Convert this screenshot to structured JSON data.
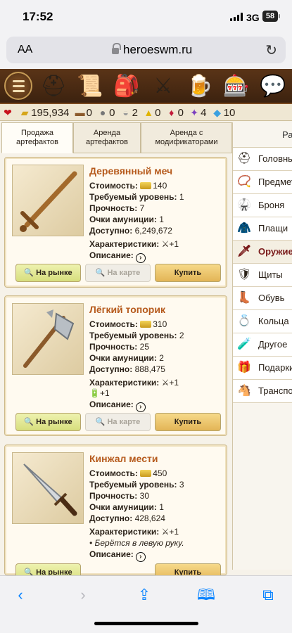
{
  "status_bar": {
    "time": "17:52",
    "network": "3G",
    "battery": "58"
  },
  "browser": {
    "text_size_label": "AA",
    "url": "heroeswm.ru"
  },
  "game_nav": {
    "icons": [
      "menu-icon",
      "helmet-icon",
      "map-scroll-icon",
      "inventory-bag-icon",
      "crossed-swords-icon",
      "tavern-mug-icon",
      "roulette-icon",
      "chat-icon"
    ]
  },
  "resources": [
    {
      "icon": "health-icon",
      "value": ""
    },
    {
      "icon": "gold-icon",
      "value": "195,934"
    },
    {
      "icon": "wood-icon",
      "value": "0"
    },
    {
      "icon": "ore-icon",
      "value": "0"
    },
    {
      "icon": "mercury-icon",
      "value": "2"
    },
    {
      "icon": "sulfur-icon",
      "value": "0"
    },
    {
      "icon": "crystal-icon",
      "value": "0"
    },
    {
      "icon": "gems-icon",
      "value": "4"
    },
    {
      "icon": "diamond-icon",
      "value": "10"
    }
  ],
  "tabs": [
    {
      "label": "Продажа артефактов"
    },
    {
      "label": "Аренда артефактов"
    },
    {
      "label": "Аренда с модификаторами"
    }
  ],
  "sidebar": {
    "header": "Ра",
    "items": [
      {
        "label": "Головные",
        "icon": "helmet-icon"
      },
      {
        "label": "Предметы",
        "icon": "necklace-icon"
      },
      {
        "label": "Броня",
        "icon": "armor-icon"
      },
      {
        "label": "Плащи",
        "icon": "cloak-icon"
      },
      {
        "label": "Оружие",
        "icon": "sword-icon"
      },
      {
        "label": "Щиты",
        "icon": "shield-icon"
      },
      {
        "label": "Обувь",
        "icon": "boots-icon"
      },
      {
        "label": "Кольца",
        "icon": "ring-icon"
      },
      {
        "label": "Другое",
        "icon": "misc-icon"
      },
      {
        "label": "Подарки",
        "icon": "gift-icon"
      },
      {
        "label": "Транспорт",
        "icon": "horse-icon"
      }
    ]
  },
  "labels": {
    "cost": "Стоимость:",
    "level": "Требуемый уровень:",
    "durability": "Прочность:",
    "ammo": "Очки амуниции:",
    "available": "Доступно:",
    "stats": "Характеристики:",
    "description": "Описание:",
    "market_btn": "На рынке",
    "map_btn": "На карте",
    "buy_btn": "Купить"
  },
  "items": [
    {
      "name": "Деревянный меч",
      "cost": "140",
      "level": "1",
      "durability": "7",
      "ammo": "1",
      "available": "6,249,672",
      "stat1": "+1",
      "stat2": "",
      "note": ""
    },
    {
      "name": "Лёгкий топорик",
      "cost": "310",
      "level": "2",
      "durability": "25",
      "ammo": "2",
      "available": "888,475",
      "stat1": "+1",
      "stat2": "+1",
      "note": ""
    },
    {
      "name": "Кинжал мести",
      "cost": "450",
      "level": "3",
      "durability": "30",
      "ammo": "1",
      "available": "428,624",
      "stat1": "+1",
      "stat2": "",
      "note": "• Берётся в левую руку."
    }
  ]
}
